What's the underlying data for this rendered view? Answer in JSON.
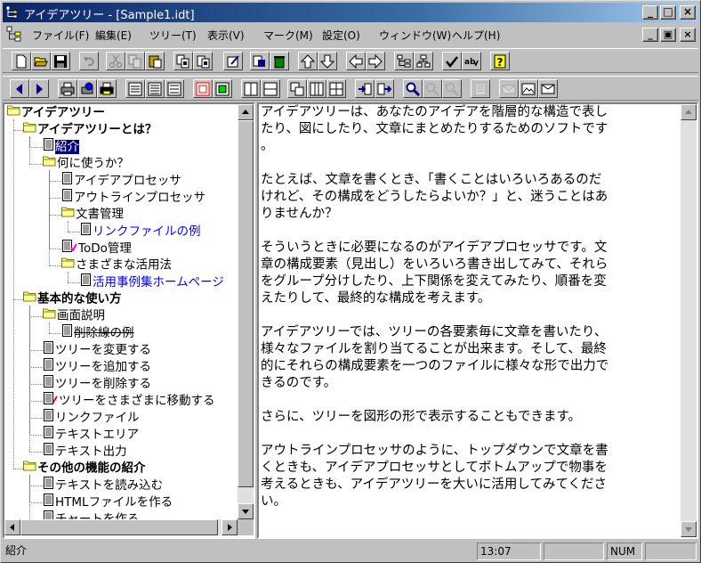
{
  "window": {
    "title": "アイデアツリー - [Sample1.idt]",
    "caption_min": "_",
    "caption_max": "□",
    "caption_close": "×",
    "mdi_min": "_",
    "mdi_restore": "▣",
    "mdi_close": "×"
  },
  "menu": [
    "ファイル(F)",
    "編集(E)",
    "ツリー(T)",
    "表示(V)",
    "マーク(M)",
    "設定(O)",
    "ウィンドウ(W)",
    "ヘルプ(H)"
  ],
  "toolbar1_icons": [
    "new-file-icon",
    "open-folder-icon",
    "save-icon",
    "undo-icon",
    "cut-icon",
    "copy-icon",
    "paste-icon",
    "copy-node-icon",
    "paste-node-icon",
    "edit-node-icon",
    "copy-tree-icon",
    "delete-icon",
    "move-up-icon",
    "move-down-icon",
    "move-left-icon",
    "move-right-icon",
    "tree-view-icon",
    "chart-view-icon",
    "check-icon",
    "spellcheck-icon",
    "help-icon"
  ],
  "toolbar2_icons": [
    "back-icon",
    "forward-icon",
    "print-icon",
    "print-preview-icon",
    "print-setup-icon",
    "outline-view-icon",
    "text-view-icon",
    "split-view-icon",
    "text-area-icon",
    "text-area-green-icon",
    "layout-vertical-icon",
    "layout-horizontal-icon",
    "layout-cascade-icon",
    "layout-columns-icon",
    "layout-grid-icon",
    "import-icon",
    "export-icon",
    "search-icon",
    "find-next-icon",
    "find-prev-icon",
    "properties-icon",
    "mail-icon",
    "image-icon",
    "image-mail-icon"
  ],
  "tree": {
    "nodes": [
      {
        "label": "アイデアツリー",
        "level": 0,
        "icon": "folder",
        "bold": true
      },
      {
        "label": "アイデアツリーとは？",
        "level": 1,
        "icon": "folder",
        "bold": true
      },
      {
        "label": "紹介",
        "level": 2,
        "icon": "doc",
        "selected": true
      },
      {
        "label": "何に使うか？",
        "level": 2,
        "icon": "folder"
      },
      {
        "label": "アイデアプロセッサ",
        "level": 3,
        "icon": "doc"
      },
      {
        "label": "アウトラインプロセッサ",
        "level": 3,
        "icon": "doc"
      },
      {
        "label": "文書管理",
        "level": 3,
        "icon": "folder"
      },
      {
        "label": "リンクファイルの例",
        "level": 4,
        "icon": "doc",
        "link": true
      },
      {
        "label": "ToDo管理",
        "level": 3,
        "icon": "doc",
        "mark": "check"
      },
      {
        "label": "さまざまな活用法",
        "level": 3,
        "icon": "folder"
      },
      {
        "label": "活用事例集ホームページ",
        "level": 4,
        "icon": "doc",
        "link": true
      },
      {
        "label": "基本的な使い方",
        "level": 1,
        "icon": "folder",
        "bold": true
      },
      {
        "label": "画面説明",
        "level": 2,
        "icon": "folder"
      },
      {
        "label": "削除線の例",
        "level": 3,
        "icon": "doc",
        "strike": true
      },
      {
        "label": "ツリーを変更する",
        "level": 2,
        "icon": "doc"
      },
      {
        "label": "ツリーを追加する",
        "level": 2,
        "icon": "doc"
      },
      {
        "label": "ツリーを削除する",
        "level": 2,
        "icon": "doc"
      },
      {
        "label": "ツリーをさまざまに移動する",
        "level": 2,
        "icon": "doc",
        "mark": "pin"
      },
      {
        "label": "リンクファイル",
        "level": 2,
        "icon": "doc"
      },
      {
        "label": "テキストエリア",
        "level": 2,
        "icon": "doc"
      },
      {
        "label": "テキスト出力",
        "level": 2,
        "icon": "doc"
      },
      {
        "label": "その他の機能の紹介",
        "level": 1,
        "icon": "folder",
        "bold": true
      },
      {
        "label": "テキストを読み込む",
        "level": 2,
        "icon": "doc"
      },
      {
        "label": "HTMLファイルを作る",
        "level": 2,
        "icon": "doc"
      },
      {
        "label": "チャートを作る",
        "level": 2,
        "icon": "doc"
      }
    ]
  },
  "document": {
    "lines": [
      "アイデアツリーは、あなたのアイデアを階層的な構造で表し",
      "たり、図にしたり、文章にまとめたりするためのソフトです",
      "。",
      "",
      "たとえば、文章を書くとき、「書くことはいろいろあるのだ",
      "けれど、その構成をどうしたらよいか？」と、迷うことはあ",
      "りませんか？",
      "",
      "そういうときに必要になるのがアイデアプロセッサです。文",
      "章の構成要素（見出し）をいろいろ書き出してみて、それら",
      "をグループ分けしたり、上下関係を変えてみたり、順番を変",
      "えたりして、最終的な構成を考えます。",
      "",
      "アイデアツリーでは、ツリーの各要素毎に文章を書いたり、",
      "様々なファイルを割り当てることが出来ます。そして、最終",
      "的にそれらの構成要素を一つのファイルに様々な形で出力で",
      "きるのです。",
      "",
      "さらに、ツリーを図形の形で表示することもできます。",
      "",
      "アウトラインプロセッサのように、トップダウンで文章を書",
      "くときも、アイデアプロセッサとしてボトムアップで物事を",
      "考えるときも、アイデアツリーを大いに活用してみてくださ",
      "い。"
    ]
  },
  "status": {
    "message": "紹介",
    "time": "13:07",
    "cell3": "",
    "num": "NUM",
    "cell5": ""
  }
}
